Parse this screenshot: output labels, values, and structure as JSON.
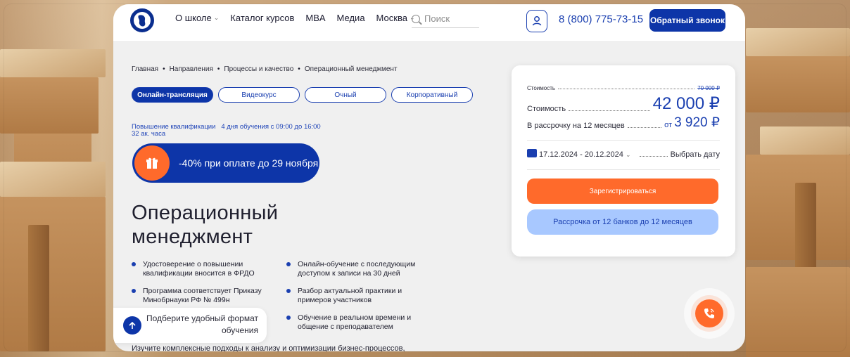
{
  "header": {
    "nav": [
      {
        "label": "О школе",
        "has_dropdown": true
      },
      {
        "label": "Каталог курсов",
        "has_dropdown": false
      },
      {
        "label": "MBA",
        "has_dropdown": false
      },
      {
        "label": "Медиа",
        "has_dropdown": false
      },
      {
        "label": "Москва",
        "has_dropdown": true
      }
    ],
    "search_placeholder": "Поиск",
    "phone": "8 (800) 775-73-15",
    "callback_label": "Обратный звонок"
  },
  "breadcrumbs": [
    "Главная",
    "Направления",
    "Процессы и качество",
    "Операционный менеджмент"
  ],
  "formats": [
    "Онлайн-трансляция",
    "Видеокурс",
    "Очный",
    "Корпоративный"
  ],
  "active_format": "Онлайн-трансляция",
  "meta": {
    "line1": "Повышение квалификации   4 дня обучения с 09:00 до 16:00",
    "line2": "32 ак. часа"
  },
  "promo": {
    "text": "-40% при оплате до 29 ноября",
    "icon": "gift-icon"
  },
  "course": {
    "title_line1": "Операционный",
    "title_line2": "менеджмент"
  },
  "bullets": [
    "Удостоверение о повышении квалификации вносится в ФРДО",
    "Онлайн-обучение с последующим доступом к записи на 30 дней",
    "Программа соответствует Приказу Минобрнауки РФ № 499н",
    "Разбор актуальной практики и примеров участников",
    "Обучение в реальном времени и общение с преподавателем"
  ],
  "description": "Изучите комплексные подходы к анализу и оптимизации бизнес-процессов,",
  "hint": {
    "text": "Подберите удобный формат обучения"
  },
  "price_card": {
    "old_label": "Стоимость",
    "old_price": "70 000 ₽",
    "price_label": "Стоимость",
    "price": "42 000 ₽",
    "installment_label": "В рассрочку на 12 месяцев",
    "installment_prefix": "от",
    "installment_price": "3 920 ₽",
    "dates": "17.12.2024 - 20.12.2024",
    "choose_date": "Выбрать дату",
    "register_label": "Зарегистрироваться",
    "installment_button": "Рассрочка от 12 банков до 12 месяцев"
  },
  "colors": {
    "brand_blue": "#0d35a8",
    "accent_orange": "#ff6a2b",
    "light_blue": "#a8c8ff"
  }
}
